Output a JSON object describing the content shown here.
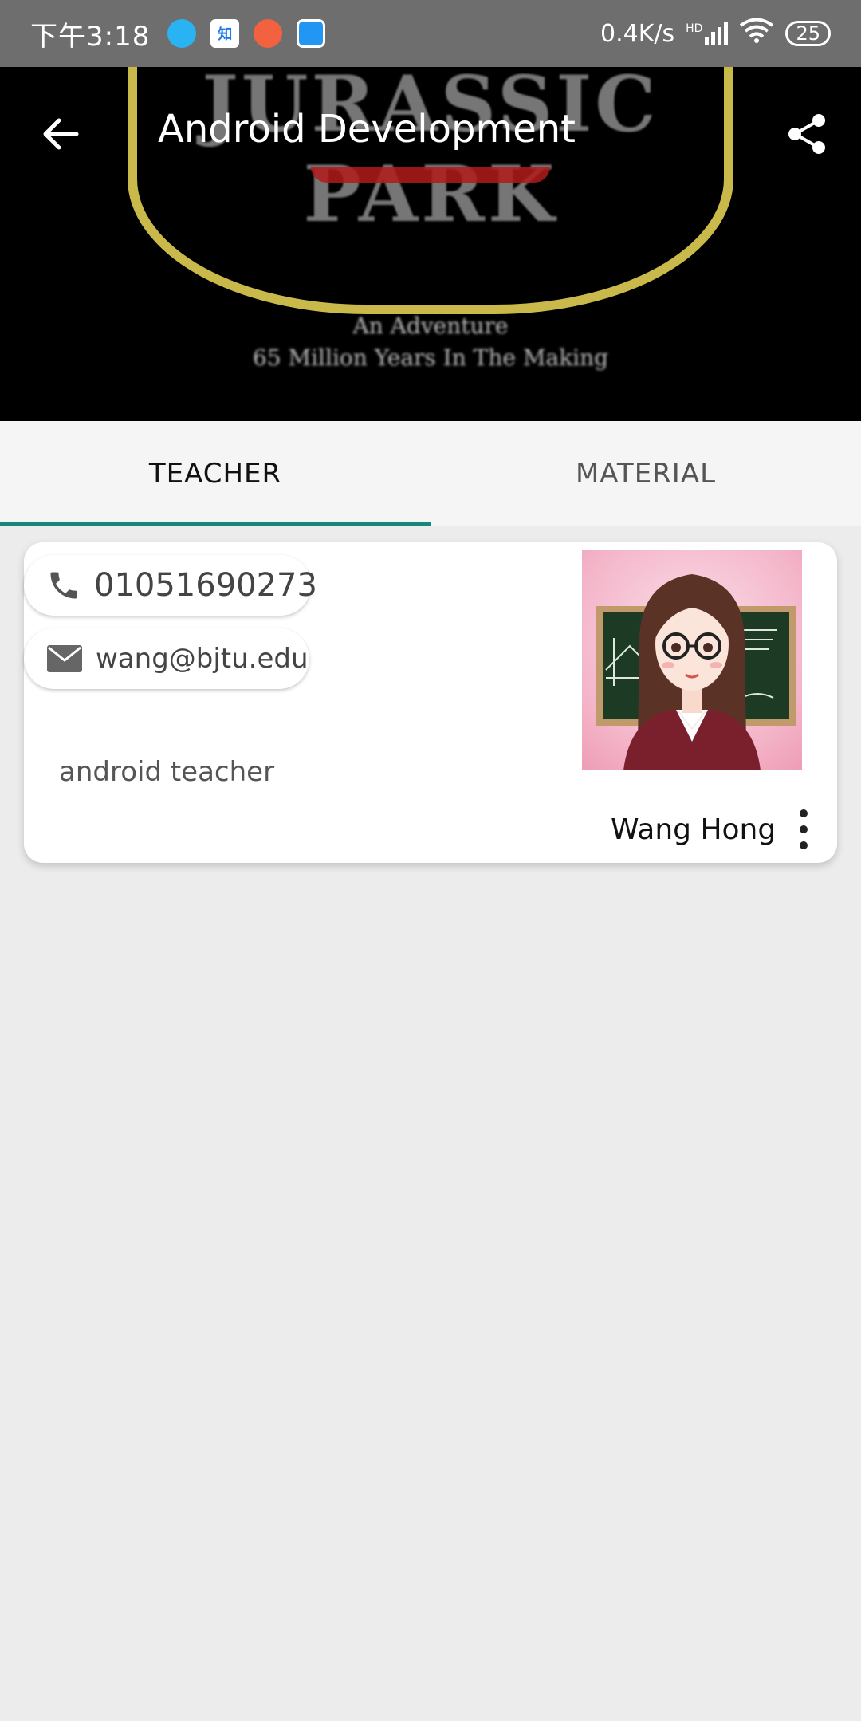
{
  "status_bar": {
    "time": "下午3:18",
    "app_icon_2_text": "知",
    "network_speed": "0.4K/s",
    "signal_badge": "HD",
    "battery": "25"
  },
  "header": {
    "title": "Android Development",
    "backdrop": {
      "logo_text": "JURASSIC PARK",
      "tagline_line1": "An Adventure",
      "tagline_line2": "65 Million Years In The Making"
    }
  },
  "tabs": [
    {
      "label": "TEACHER",
      "active": true
    },
    {
      "label": "MATERIAL",
      "active": false
    }
  ],
  "teacher_card": {
    "phone": "01051690273",
    "email": "wang@bjtu.edu",
    "description": "android teacher",
    "name": "Wang Hong"
  },
  "colors": {
    "status_bar": "#6e6e6e",
    "tab_indicator": "#16877a",
    "background": "#ececec"
  },
  "icons": {
    "back": "arrow-left",
    "share": "share",
    "phone": "phone",
    "email": "envelope",
    "more": "vertical-ellipsis"
  }
}
